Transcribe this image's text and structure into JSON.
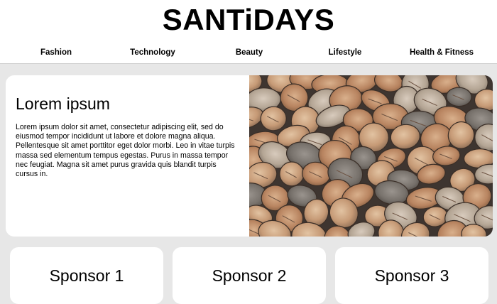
{
  "header": {
    "brand": "SANTiDAYS"
  },
  "nav": {
    "items": [
      {
        "label": "Fashion"
      },
      {
        "label": "Technology"
      },
      {
        "label": "Beauty"
      },
      {
        "label": "Lifestyle"
      },
      {
        "label": "Health & Fitness"
      }
    ]
  },
  "hero": {
    "title": "Lorem ipsum",
    "body": "Lorem ipsum dolor sit amet, consectetur adipiscing elit, sed do eiusmod tempor incididunt ut labore et dolore magna aliqua. Pellentesque sit amet porttitor eget dolor morbi. Leo in vitae turpis massa sed elementum tempus egestas. Purus in massa tempor nec feugiat. Magna sit amet purus gravida quis blandit turpis cursus in."
  },
  "sponsors": [
    {
      "label": "Sponsor 1"
    },
    {
      "label": "Sponsor 2"
    },
    {
      "label": "Sponsor 3"
    }
  ],
  "colors": {
    "page_background": "#e7e7e7",
    "card_background": "#ffffff",
    "text": "#000000"
  }
}
